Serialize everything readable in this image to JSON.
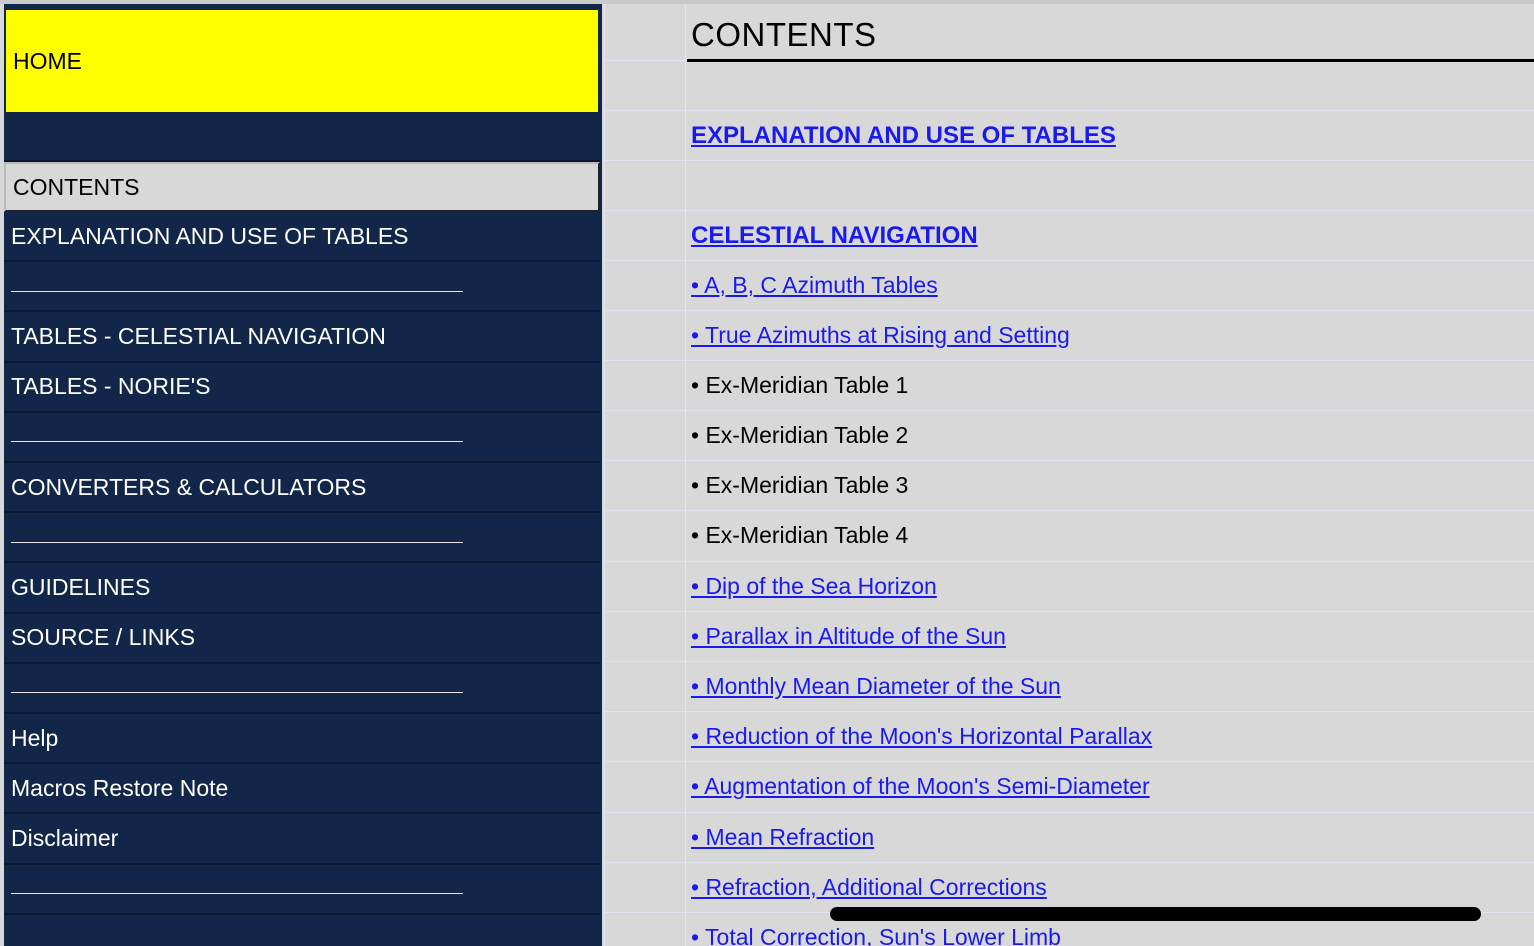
{
  "sidebar": {
    "home": "HOME",
    "contents": "CONTENTS",
    "items": [
      {
        "label": "EXPLANATION AND USE OF TABLES",
        "type": "link"
      },
      {
        "label": "",
        "type": "divider"
      },
      {
        "label": "TABLES - CELESTIAL NAVIGATION",
        "type": "link"
      },
      {
        "label": "TABLES - NORIE'S",
        "type": "link"
      },
      {
        "label": "",
        "type": "divider"
      },
      {
        "label": "CONVERTERS & CALCULATORS",
        "type": "link"
      },
      {
        "label": "",
        "type": "divider"
      },
      {
        "label": "GUIDELINES",
        "type": "link"
      },
      {
        "label": "SOURCE / LINKS",
        "type": "link"
      },
      {
        "label": "",
        "type": "divider"
      },
      {
        "label": "Help",
        "type": "link"
      },
      {
        "label": "Macros Restore Note",
        "type": "link"
      },
      {
        "label": "Disclaimer",
        "type": "link"
      },
      {
        "label": "",
        "type": "divider"
      }
    ]
  },
  "main": {
    "title": "CONTENTS",
    "sections": [
      {
        "label": "EXPLANATION AND USE OF TABLES",
        "style": "heading"
      },
      {
        "label": "CELESTIAL NAVIGATION",
        "style": "heading"
      },
      {
        "label": "• A, B, C Azimuth Tables",
        "style": "link"
      },
      {
        "label": "• True Azimuths at Rising and Setting",
        "style": "link"
      },
      {
        "label": "• Ex-Meridian Table 1",
        "style": "plain"
      },
      {
        "label": "• Ex-Meridian Table 2",
        "style": "plain"
      },
      {
        "label": "• Ex-Meridian Table 3",
        "style": "plain"
      },
      {
        "label": "• Ex-Meridian Table 4",
        "style": "plain"
      },
      {
        "label": "• Dip of the Sea Horizon",
        "style": "link"
      },
      {
        "label": "• Parallax in Altitude of the Sun",
        "style": "link"
      },
      {
        "label": "• Monthly Mean Diameter of the Sun",
        "style": "link"
      },
      {
        "label": "• Reduction of the Moon's Horizontal Parallax",
        "style": "link"
      },
      {
        "label": "• Augmentation of the Moon's Semi-Diameter",
        "style": "link"
      },
      {
        "label": "• Mean Refraction",
        "style": "link"
      },
      {
        "label": "• Refraction, Additional Corrections",
        "style": "link"
      },
      {
        "label": "• Total Correction, Sun's Lower Limb",
        "style": "link"
      }
    ]
  },
  "colors": {
    "sidebar_bg": "#12264a",
    "home_bg": "#ffff00",
    "sheet_bg": "#d8d8d8",
    "link": "#1a1aee"
  }
}
